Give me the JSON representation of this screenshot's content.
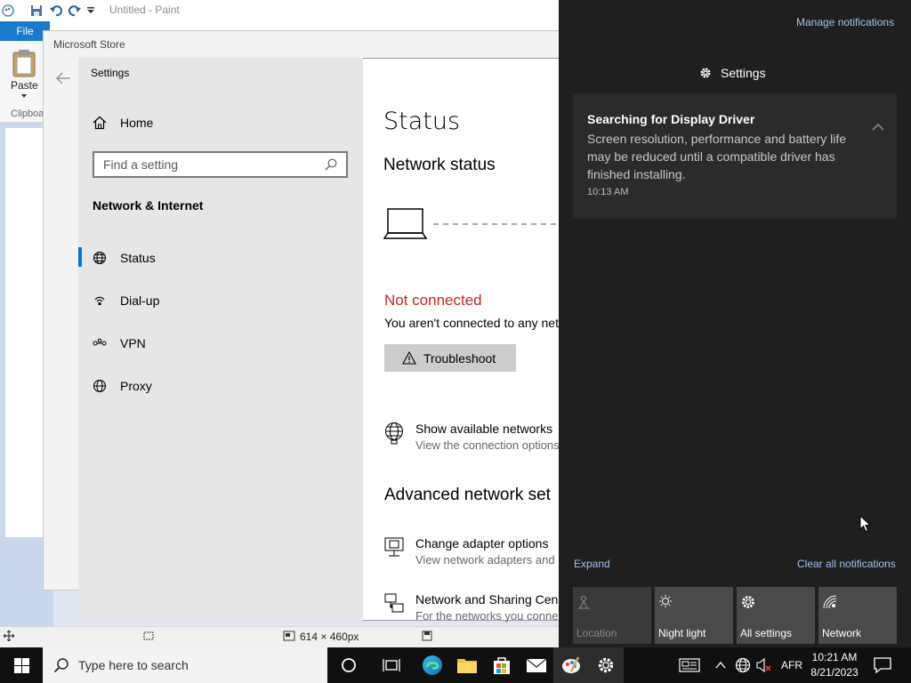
{
  "paint": {
    "title": "Untitled - Paint",
    "file_tab": "File",
    "paste_label": "Paste",
    "clipboard_label": "Clipboa",
    "dimensions": "614 × 460px"
  },
  "store": {
    "title": "Microsoft Store"
  },
  "settings": {
    "window_title": "Settings",
    "home_label": "Home",
    "search_placeholder": "Find a setting",
    "section_title": "Network & Internet",
    "nav_items": [
      {
        "label": "Status",
        "icon": "globe-status-icon",
        "active": true
      },
      {
        "label": "Dial-up",
        "icon": "dialup-icon",
        "active": false
      },
      {
        "label": "VPN",
        "icon": "vpn-icon",
        "active": false
      },
      {
        "label": "Proxy",
        "icon": "globe-icon",
        "active": false
      }
    ],
    "content": {
      "heading": "Status",
      "network_status": "Network status",
      "not_connected": "Not connected",
      "not_connected_desc": "You aren't connected to any net",
      "troubleshoot_label": "Troubleshoot",
      "show_networks_title": "Show available networks",
      "show_networks_desc": "View the connection options",
      "advanced_heading": "Advanced network set",
      "adapter_title": "Change adapter options",
      "adapter_desc": "View network adapters and",
      "sharing_title": "Network and Sharing Cen",
      "sharing_desc": "For the networks you conne"
    },
    "colors": {
      "accent": "#0078d7",
      "error": "#c42b1c"
    }
  },
  "action_center": {
    "manage_label": "Manage notifications",
    "header_label": "Settings",
    "notification": {
      "title": "Searching for Display Driver",
      "body": "Screen resolution, performance and battery life may be reduced until a compatible driver has finished installing.",
      "time": "10:13 AM"
    },
    "expand_label": "Expand",
    "clear_label": "Clear all notifications",
    "quick_actions": [
      {
        "label": "Location",
        "icon": "location-icon",
        "enabled": false
      },
      {
        "label": "Night light",
        "icon": "night-light-icon",
        "enabled": true
      },
      {
        "label": "All settings",
        "icon": "gear-icon",
        "enabled": true
      },
      {
        "label": "Network",
        "icon": "network-icon",
        "enabled": true
      }
    ]
  },
  "taskbar": {
    "search_placeholder": "Type here to search",
    "language": "AFR",
    "time": "10:21 AM",
    "date": "8/21/2023"
  }
}
